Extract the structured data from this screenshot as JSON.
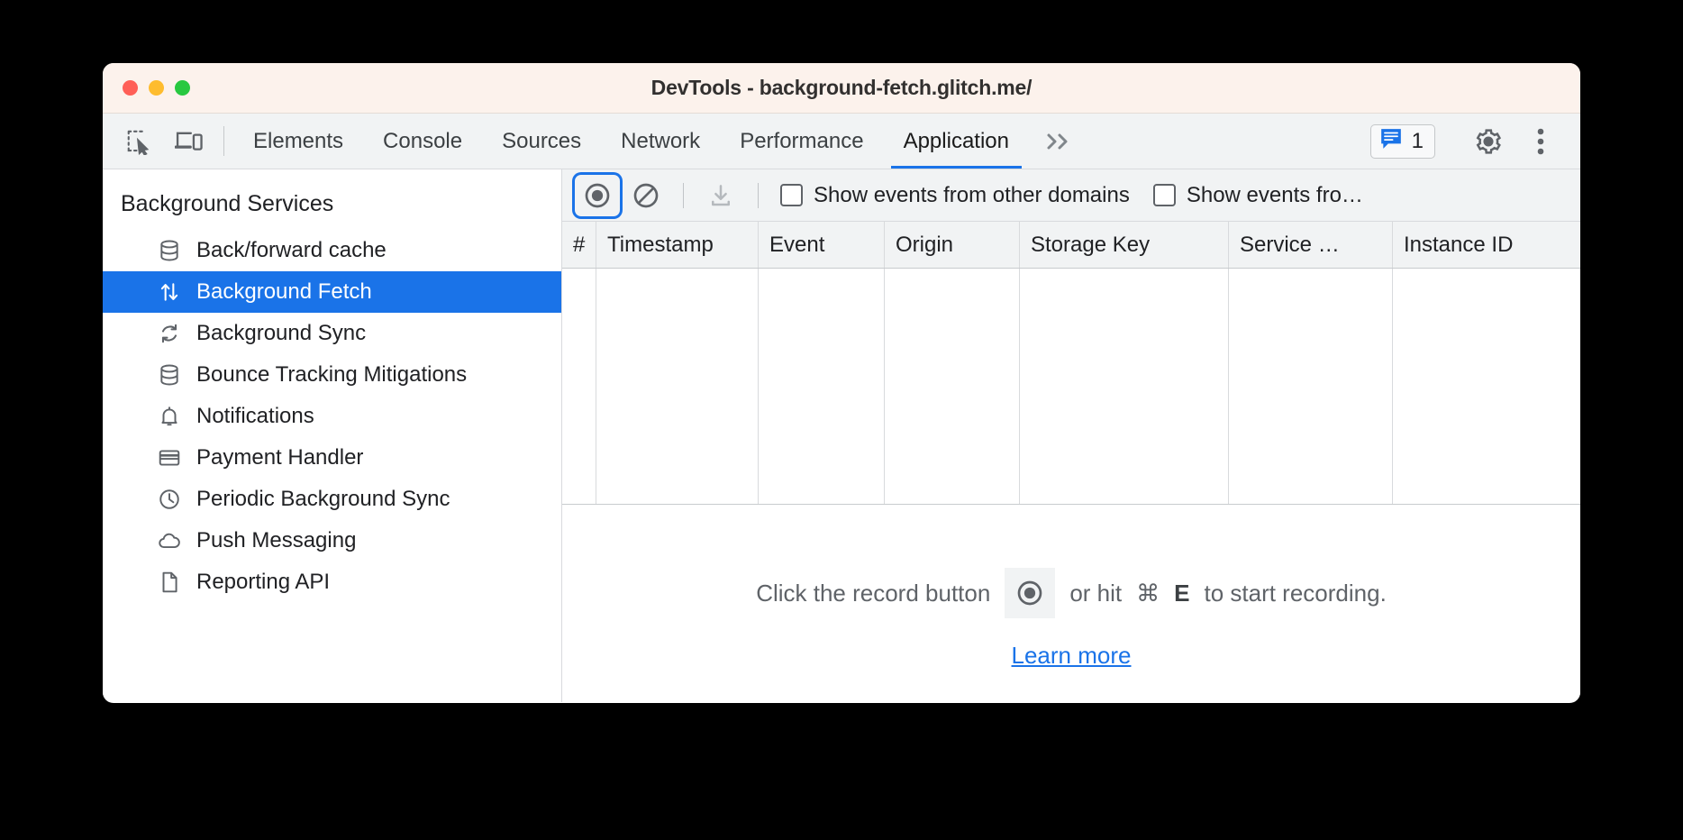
{
  "window": {
    "title": "DevTools - background-fetch.glitch.me/",
    "traffic_lights": [
      "close",
      "minimize",
      "maximize"
    ]
  },
  "tabbar": {
    "left_icons": [
      {
        "name": "inspect-element-icon",
        "label": "Inspect element"
      },
      {
        "name": "device-toolbar-icon",
        "label": "Toggle device toolbar"
      }
    ],
    "tabs": [
      {
        "label": "Elements",
        "active": false
      },
      {
        "label": "Console",
        "active": false
      },
      {
        "label": "Sources",
        "active": false
      },
      {
        "label": "Network",
        "active": false
      },
      {
        "label": "Performance",
        "active": false
      },
      {
        "label": "Application",
        "active": true
      }
    ],
    "more_tabs_label": "»",
    "message_count": "1",
    "settings_label": "Settings",
    "more_options_label": "Customize and control DevTools"
  },
  "sidebar": {
    "title": "Background Services",
    "items": [
      {
        "label": "Back/forward cache",
        "icon": "database-icon",
        "selected": false
      },
      {
        "label": "Background Fetch",
        "icon": "up-down-arrows-icon",
        "selected": true
      },
      {
        "label": "Background Sync",
        "icon": "sync-icon",
        "selected": false
      },
      {
        "label": "Bounce Tracking Mitigations",
        "icon": "database-icon",
        "selected": false
      },
      {
        "label": "Notifications",
        "icon": "bell-icon",
        "selected": false
      },
      {
        "label": "Payment Handler",
        "icon": "credit-card-icon",
        "selected": false
      },
      {
        "label": "Periodic Background Sync",
        "icon": "clock-icon",
        "selected": false
      },
      {
        "label": "Push Messaging",
        "icon": "cloud-icon",
        "selected": false
      },
      {
        "label": "Reporting API",
        "icon": "document-icon",
        "selected": false
      }
    ]
  },
  "panel_toolbar": {
    "record_label": "Start recording events",
    "clear_label": "Clear",
    "save_label": "Save events",
    "checkboxes": [
      {
        "label": "Show events from other domains",
        "checked": false
      },
      {
        "label": "Show events fro…",
        "checked": false
      }
    ]
  },
  "grid": {
    "columns": [
      "#",
      "Timestamp",
      "Event",
      "Origin",
      "Storage Key",
      "Service …",
      "Instance ID"
    ],
    "rows": []
  },
  "empty_state": {
    "prefix": "Click the record button",
    "record_icon_label": "record-icon",
    "middle": "or hit",
    "cmd_key": "⌘",
    "shortcut_key": "E",
    "suffix": "to start recording.",
    "learn_more": "Learn more"
  },
  "colors": {
    "accent": "#1a73e8",
    "titlebar_bg": "#fcf2ec",
    "toolbar_bg": "#f1f3f4",
    "selection_bg": "#1a73e8",
    "icon_gray": "#5f6368",
    "link": "#1a73e8"
  }
}
